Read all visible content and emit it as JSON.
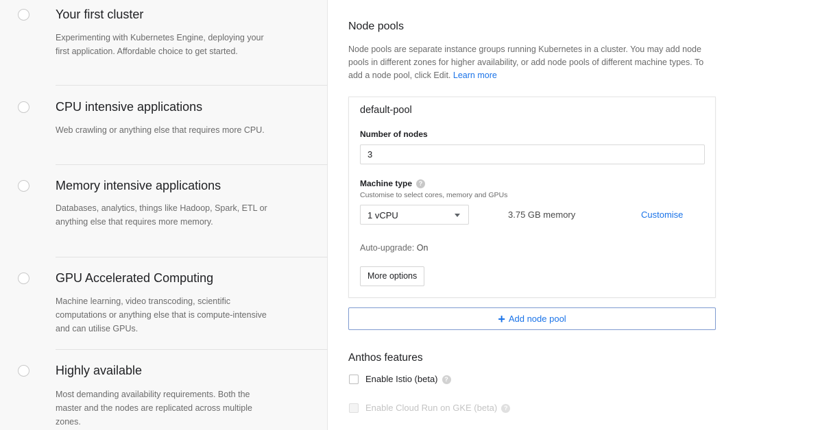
{
  "templates": [
    {
      "title": "Your first cluster",
      "desc": "Experimenting with Kubernetes Engine, deploying your first application. Affordable choice to get started."
    },
    {
      "title": "CPU intensive applications",
      "desc": "Web crawling or anything else that requires more CPU."
    },
    {
      "title": "Memory intensive applications",
      "desc": "Databases, analytics, things like Hadoop, Spark, ETL or anything else that requires more memory."
    },
    {
      "title": "GPU Accelerated Computing",
      "desc": "Machine learning, video transcoding, scientific computations or anything else that is compute-intensive and can utilise GPUs."
    },
    {
      "title": "Highly available",
      "desc": "Most demanding availability requirements. Both the master and the nodes are replicated across multiple zones."
    }
  ],
  "node_pools": {
    "title": "Node pools",
    "desc": "Node pools are separate instance groups running Kubernetes in a cluster. You may add node pools in different zones for higher availability, or add node pools of different machine types. To add a node pool, click Edit.",
    "learn_more": "Learn more"
  },
  "pool": {
    "name": "default-pool",
    "nodes_label": "Number of nodes",
    "nodes_value": "3",
    "machine_label": "Machine type",
    "machine_sub": "Customise to select cores, memory and GPUs",
    "machine_value": "1 vCPU",
    "memory": "3.75 GB memory",
    "customise": "Customise",
    "auto_upgrade_label": "Auto-upgrade:",
    "auto_upgrade_value": "On",
    "more_options": "More options"
  },
  "add_pool": "Add node pool",
  "anthos": {
    "title": "Anthos features",
    "istio": "Enable Istio (beta)",
    "cloud_run": "Enable Cloud Run on GKE (beta)"
  },
  "icons": {
    "help": "?",
    "plus": "+"
  }
}
